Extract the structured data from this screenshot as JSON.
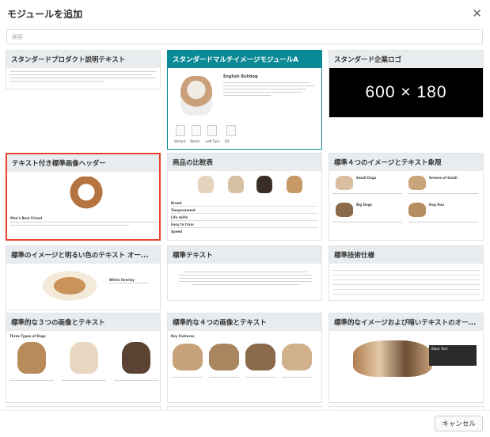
{
  "dialog": {
    "title": "モジュールを追加",
    "search_placeholder": "検索",
    "cancel_label": "キャンセル"
  },
  "colors": {
    "active_header": "#0a8a96",
    "selected_border": "#e8412c",
    "tile_header": "#e9ecef"
  },
  "tiles": [
    {
      "title": "スタンダードプロダクト説明テキスト"
    },
    {
      "title": "スタンダードマルチイメージモジュールA",
      "preview_heading": "English Bulldog",
      "preview_caption_lines": [
        "Variant",
        "Stand",
        "Left Turn",
        "Sit"
      ]
    },
    {
      "title": "スタンダード企業ロゴ",
      "logo_size": "600 × 180"
    },
    {
      "title": "テキスト付き標準画像ヘッダー",
      "preview_caption": "Man's Best Friend"
    },
    {
      "title": "商品の比較表",
      "row_labels": [
        "Breed",
        "Temperament",
        "Life skills",
        "Easy to train",
        "Speed"
      ]
    },
    {
      "title": "標準４つのイメージとテキスト象限",
      "labels": [
        "Small Dogs",
        "Greens of Small",
        "Big Dogs",
        "Dog Run"
      ]
    },
    {
      "title": "標準のイメージと明るい色のテキスト オー...",
      "preview_caption": "White Overlay"
    },
    {
      "title": "標準テキスト"
    },
    {
      "title": "標準技術仕様"
    },
    {
      "title": "標準的な３つの画像とテキスト",
      "preview_heading": "Three Types of Dogs"
    },
    {
      "title": "標準的な４つの画像とテキスト",
      "preview_heading": "Key Features"
    },
    {
      "title": "標準的なイメージおよび暗いテキストのオー...",
      "preview_caption": "Black Text"
    }
  ]
}
